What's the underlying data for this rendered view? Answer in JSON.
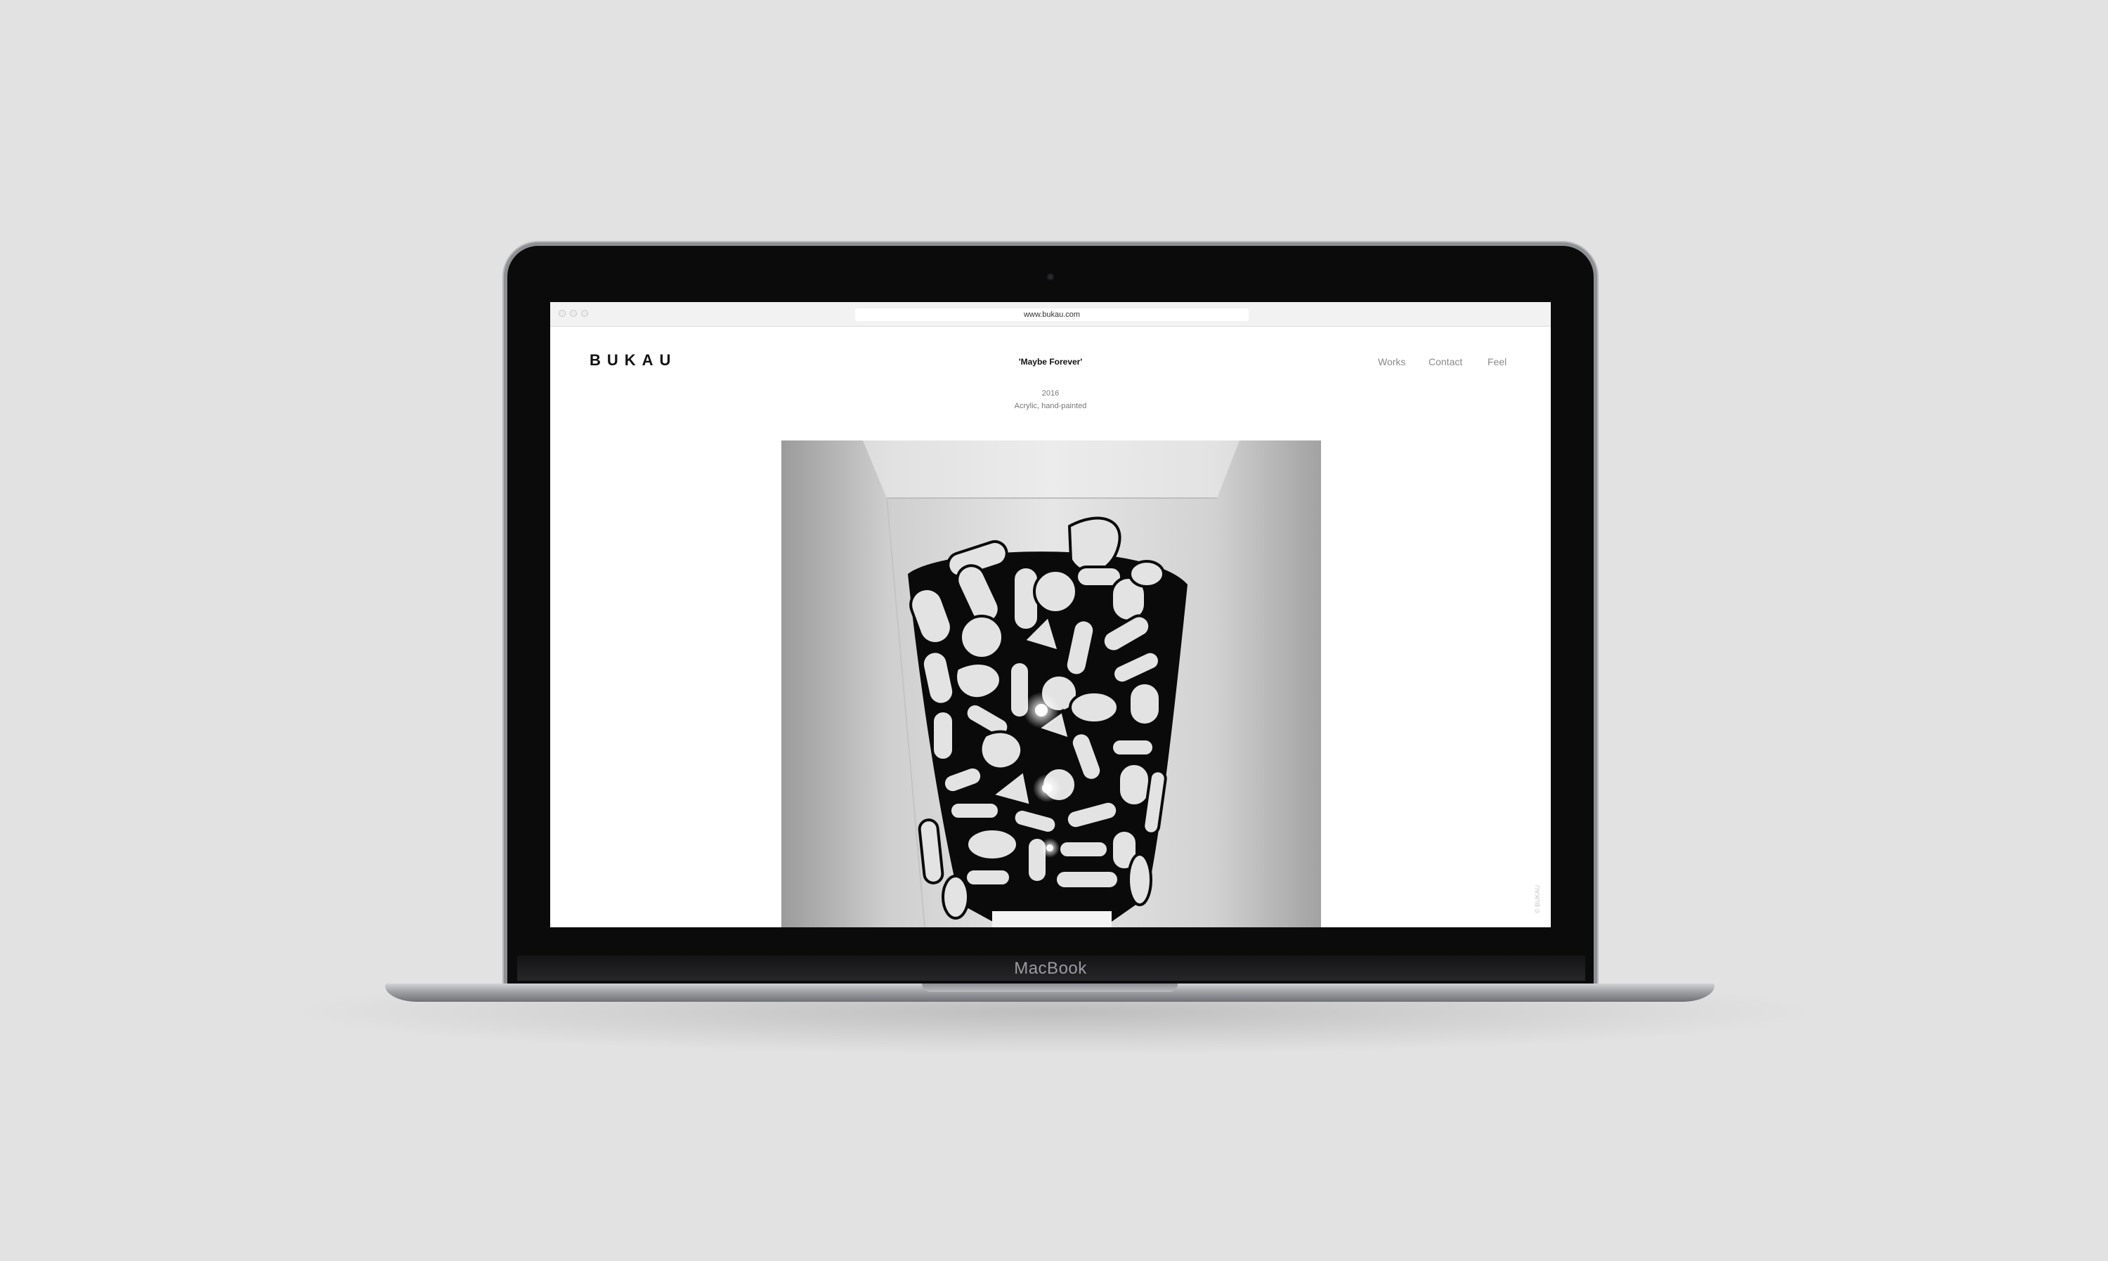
{
  "device": {
    "brand_label": "MacBook"
  },
  "browser": {
    "url": "www.bukau.com"
  },
  "site": {
    "logo": "BUKAU",
    "nav": [
      "Works",
      "Contact",
      "Feel"
    ],
    "copyright": "© BUKAU"
  },
  "artwork": {
    "title": "'Maybe Forever'",
    "year": "2016",
    "medium": "Acrylic, hand-painted"
  }
}
